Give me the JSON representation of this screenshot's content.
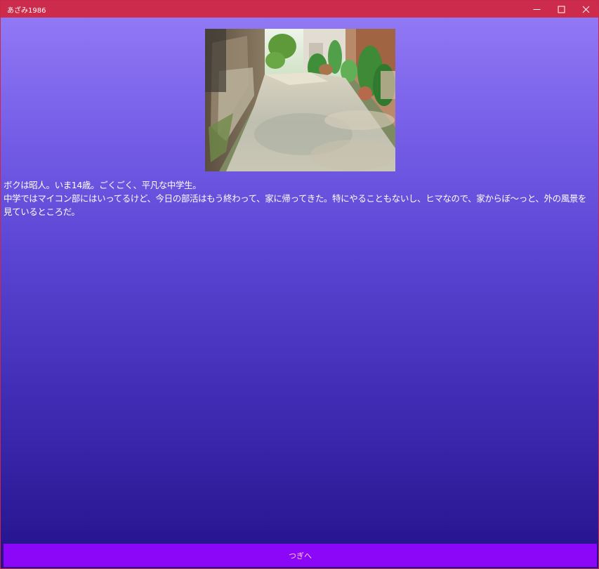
{
  "window": {
    "title": "あざみ1986",
    "controls": [
      "minimize-icon",
      "maximize-icon",
      "close-icon"
    ],
    "accent_color": "#cd2b4b"
  },
  "scene": {
    "icon": "alley-photo"
  },
  "story": {
    "line1": "ボクは昭人。いま14歳。ごくごく、平凡な中学生。",
    "line2": "中学ではマイコン部にはいってるけど、今日の部活はもう終わって、家に帰ってきた。特にやることもないし、ヒマなので、家からぼ〜っと、外の風景を見ているところだ。"
  },
  "actions": {
    "next_label": "つぎへ",
    "next_color": "#8c06f8"
  }
}
